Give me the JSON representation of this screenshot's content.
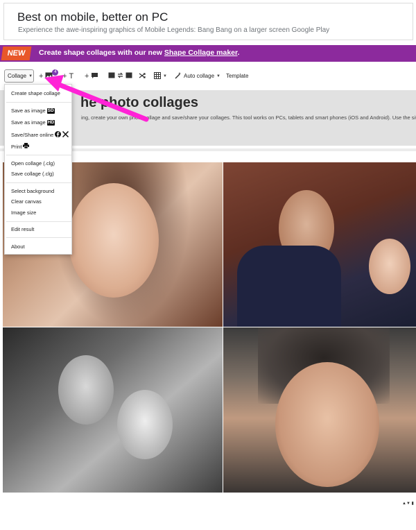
{
  "ad": {
    "title": "Best on mobile, better on PC",
    "subtitle": "Experience the awe-inspiring graphics of Mobile Legends: Bang Bang on a larger screen Google Play"
  },
  "banner": {
    "badge": "NEW",
    "text": "Create shape collages with our new ",
    "link": "Shape Collage maker",
    "suffix": "."
  },
  "toolbar": {
    "collage_label": "Collage",
    "add_image_count": "4",
    "auto_collage_label": "Auto collage",
    "template_label": "Template",
    "add_glyph": "+",
    "text_glyph": "T"
  },
  "content": {
    "title": "he photo collages",
    "description": "ing, create your own photo collage and save/share your collages. This tool works on PCs, tablets and smart phones (iOS and Android). Use the site witho"
  },
  "menu": {
    "items": [
      "Create shape collage",
      "Save as image",
      "SD",
      "Save as image",
      "HD",
      "Save/Share online",
      "Print",
      "Open collage (.clg)",
      "Save collage (.clg)",
      "Select background",
      "Clear canvas",
      "Image size",
      "Edit result",
      "About"
    ]
  },
  "colors": {
    "banner": "#8c2a9d",
    "new_badge": "#e8572a",
    "annotation_arrow": "#ff22d6"
  }
}
